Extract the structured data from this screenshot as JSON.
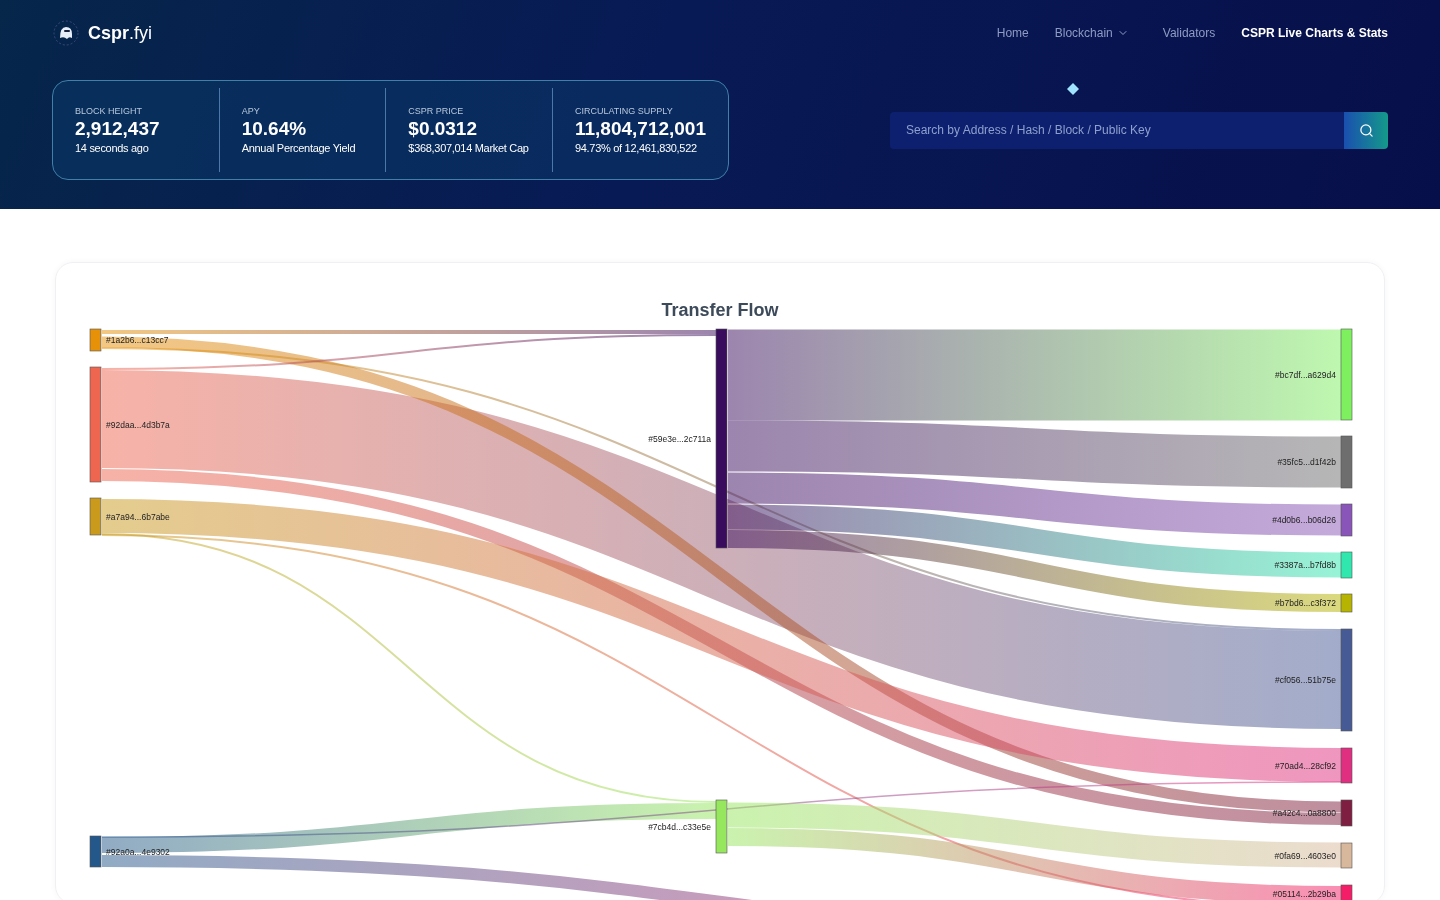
{
  "brand": {
    "name_bold": "Cspr",
    "name_rest": ".fyi"
  },
  "nav": [
    {
      "label": "Home",
      "selected": false,
      "dropdown": false
    },
    {
      "label": "Blockchain",
      "selected": false,
      "dropdown": true
    },
    {
      "label": "Validators",
      "selected": false,
      "dropdown": false
    },
    {
      "label": "CSPR Live Charts & Stats",
      "selected": true,
      "dropdown": false
    }
  ],
  "stats": [
    {
      "label": "BLOCK HEIGHT",
      "value": "2,912,437",
      "sub": "14 seconds ago"
    },
    {
      "label": "APY",
      "value": "10.64%",
      "sub": "Annual Percentage Yield"
    },
    {
      "label": "CSPR PRICE",
      "value": "$0.0312",
      "sub": "$368,307,014 Market Cap"
    },
    {
      "label": "CIRCULATING SUPPLY",
      "value": "11,804,712,001",
      "sub": "94.73% of 12,461,830,522"
    }
  ],
  "search": {
    "placeholder": "Search by Address / Hash / Block / Public Key"
  },
  "transfer_flow": {
    "title": "Transfer Flow",
    "nodes": [
      {
        "label": "#1a2b6...c13cc7",
        "color": "#e69108"
      },
      {
        "label": "#92daa...4d3b7a",
        "color": "#ef6650"
      },
      {
        "label": "#a7a94...6b7abe",
        "color": "#c99a1c"
      },
      {
        "label": "#92a0a...4e9302",
        "color": "#24578a"
      },
      {
        "label": "#59e3e...2c711a",
        "color": "#3a0c5e"
      },
      {
        "label": "#7cb4d...c33e5e",
        "color": "#96e65e"
      },
      {
        "label": "#bc7df...a629d4",
        "color": "#7ef060"
      },
      {
        "label": "#35fc5...d1f42b",
        "color": "#6e6e6e"
      },
      {
        "label": "#4d0b6...b06d26",
        "color": "#8a55b8"
      },
      {
        "label": "#3387a...b7fd8b",
        "color": "#30e8ae"
      },
      {
        "label": "#b7bd6...c3f372",
        "color": "#b6b400"
      },
      {
        "label": "#cf056...51b75e",
        "color": "#465a96"
      },
      {
        "label": "#70ad4...28cf92",
        "color": "#e02e80"
      },
      {
        "label": "#a42c4...0a8800",
        "color": "#7e1e40"
      },
      {
        "label": "#0fa69...4603e0",
        "color": "#d8b89c"
      },
      {
        "label": "#05114...2b29ba",
        "color": "#f41e68"
      }
    ]
  }
}
